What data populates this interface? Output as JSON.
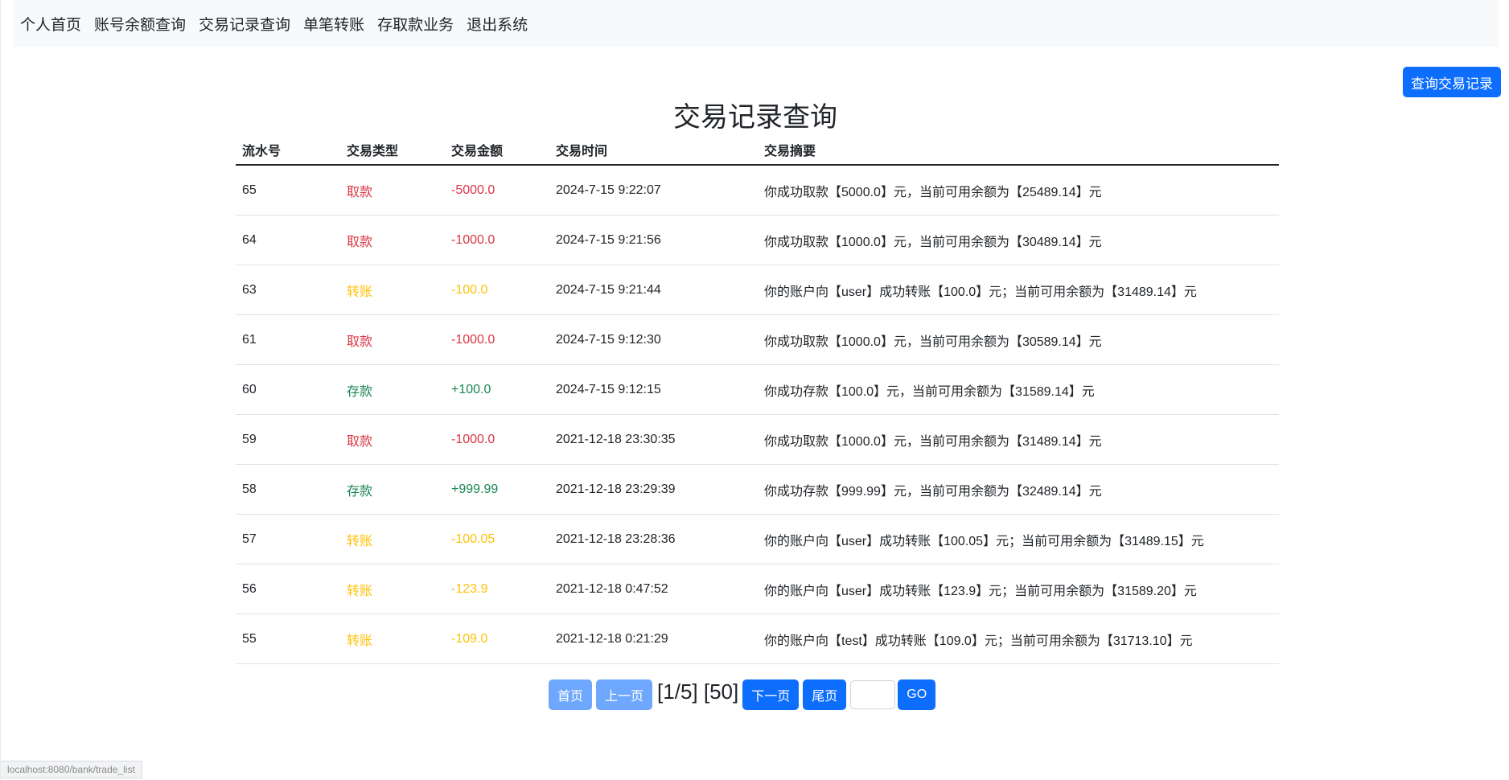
{
  "nav": {
    "items": [
      {
        "label": "个人首页"
      },
      {
        "label": "账号余额查询"
      },
      {
        "label": "交易记录查询"
      },
      {
        "label": "单笔转账"
      },
      {
        "label": "存取款业务"
      },
      {
        "label": "退出系统"
      }
    ]
  },
  "query_button_label": "查询交易记录",
  "title": "交易记录查询",
  "table": {
    "headers": [
      "流水号",
      "交易类型",
      "交易金额",
      "交易时间",
      "交易摘要"
    ],
    "type_colors": {
      "取款": "#dc3545",
      "转账": "#ffc107",
      "存款": "#198754"
    },
    "rows": [
      {
        "id": "65",
        "type": "取款",
        "amount": "-5000.0",
        "time": "2024-7-15 9:22:07",
        "summary": "你成功取款【5000.0】元，当前可用余额为【25489.14】元"
      },
      {
        "id": "64",
        "type": "取款",
        "amount": "-1000.0",
        "time": "2024-7-15 9:21:56",
        "summary": "你成功取款【1000.0】元，当前可用余额为【30489.14】元"
      },
      {
        "id": "63",
        "type": "转账",
        "amount": "-100.0",
        "time": "2024-7-15 9:21:44",
        "summary": "你的账户向【user】成功转账【100.0】元；当前可用余额为【31489.14】元"
      },
      {
        "id": "61",
        "type": "取款",
        "amount": "-1000.0",
        "time": "2024-7-15 9:12:30",
        "summary": "你成功取款【1000.0】元，当前可用余额为【30589.14】元"
      },
      {
        "id": "60",
        "type": "存款",
        "amount": "+100.0",
        "time": "2024-7-15 9:12:15",
        "summary": "你成功存款【100.0】元，当前可用余额为【31589.14】元"
      },
      {
        "id": "59",
        "type": "取款",
        "amount": "-1000.0",
        "time": "2021-12-18 23:30:35",
        "summary": "你成功取款【1000.0】元，当前可用余额为【31489.14】元"
      },
      {
        "id": "58",
        "type": "存款",
        "amount": "+999.99",
        "time": "2021-12-18 23:29:39",
        "summary": "你成功存款【999.99】元，当前可用余额为【32489.14】元"
      },
      {
        "id": "57",
        "type": "转账",
        "amount": "-100.05",
        "time": "2021-12-18 23:28:36",
        "summary": "你的账户向【user】成功转账【100.05】元；当前可用余额为【31489.15】元"
      },
      {
        "id": "56",
        "type": "转账",
        "amount": "-123.9",
        "time": "2021-12-18 0:47:52",
        "summary": "你的账户向【user】成功转账【123.9】元；当前可用余额为【31589.20】元"
      },
      {
        "id": "55",
        "type": "转账",
        "amount": "-109.0",
        "time": "2021-12-18 0:21:29",
        "summary": "你的账户向【test】成功转账【109.0】元；当前可用余额为【31713.10】元"
      }
    ]
  },
  "pager": {
    "first": "首页",
    "prev": "上一页",
    "info": "[1/5] [50]",
    "next": "下一页",
    "last": "尾页",
    "go": "GO",
    "input_value": ""
  },
  "status_url": "localhost:8080/bank/trade_list"
}
